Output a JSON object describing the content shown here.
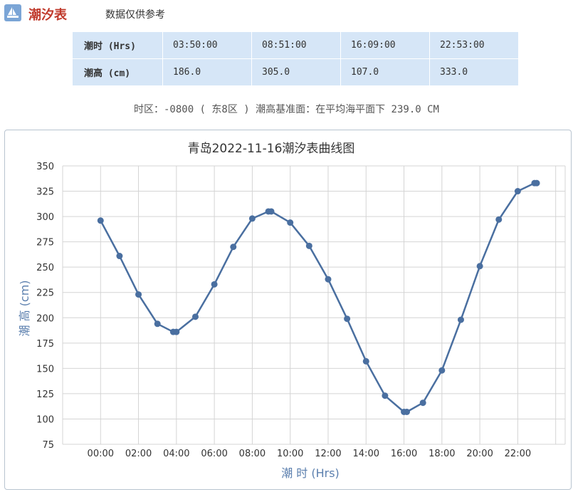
{
  "header": {
    "title": "潮汐表",
    "note": "数据仅供参考"
  },
  "tide_table": {
    "time_label": "潮时 (Hrs)",
    "height_label": "潮高 (cm)",
    "times": [
      "03:50:00",
      "08:51:00",
      "16:09:00",
      "22:53:00"
    ],
    "heights": [
      "186.0",
      "305.0",
      "107.0",
      "333.0"
    ]
  },
  "timezone_line": "时区：-0800 ( 东8区 ) 潮高基准面：在平均海平面下 239.0 CM",
  "colors": {
    "line": "#4a6fa0",
    "title_red": "#c0392b",
    "cell_bg": "#d6e6f7"
  },
  "chart_data": {
    "type": "line",
    "title": "青岛2022-11-16潮汐表曲线图",
    "xlabel": "潮 时 (Hrs)",
    "ylabel": "潮 高 (cm)",
    "x_ticks": [
      "00:00",
      "02:00",
      "04:00",
      "06:00",
      "08:00",
      "10:00",
      "12:00",
      "14:00",
      "16:00",
      "18:00",
      "20:00",
      "22:00"
    ],
    "y_ticks": [
      75,
      100,
      125,
      150,
      175,
      200,
      225,
      250,
      275,
      300,
      325,
      350
    ],
    "ylim": [
      75,
      350
    ],
    "xlim_hours": [
      -2,
      24.5
    ],
    "grid": true,
    "series": [
      {
        "x": [
          0,
          1,
          2,
          3,
          3.833,
          4,
          5,
          6,
          7,
          8,
          8.85,
          9,
          10,
          11,
          12,
          13,
          14,
          15,
          16,
          16.15,
          17,
          18,
          19,
          20,
          21,
          22,
          22.883,
          23
        ],
        "y": [
          296,
          261,
          223,
          194,
          186,
          186,
          201,
          233,
          270,
          298,
          305,
          305,
          294,
          271,
          238,
          199,
          157,
          123,
          107,
          107,
          116,
          148,
          198,
          251,
          297,
          325,
          333,
          333
        ]
      }
    ]
  }
}
